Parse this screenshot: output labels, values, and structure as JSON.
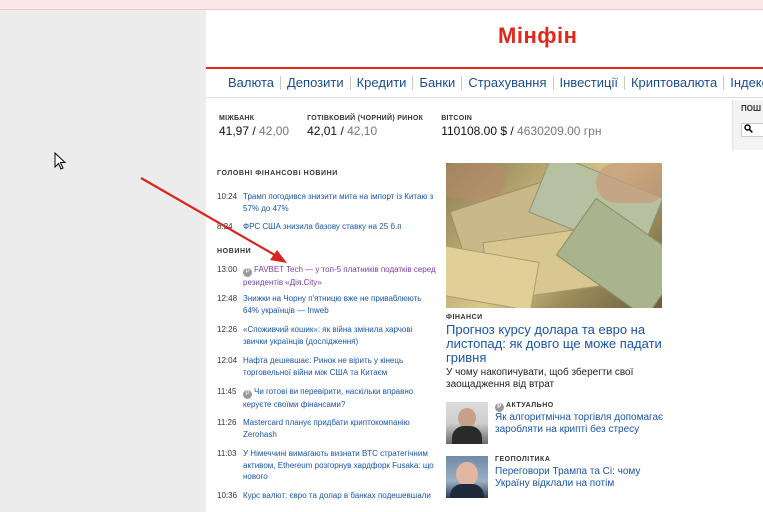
{
  "site": {
    "logo": "Мінфін"
  },
  "nav": [
    "Валюта",
    "Депозити",
    "Кредити",
    "Банки",
    "Страхування",
    "Інвестиції",
    "Криптовалюта",
    "Індекси"
  ],
  "rates": [
    {
      "label": "МІЖБАНК",
      "buy": "41,97",
      "sep": " / ",
      "sell": "42,00"
    },
    {
      "label": "ГОТІВКОВИЙ (ЧОРНИЙ) РИНОК",
      "buy": "42,01",
      "sep": " / ",
      "sell": "42,10"
    },
    {
      "label": "BITCOIN",
      "buy": "110108.00 $",
      "sep": " / ",
      "sell": "4630209.00 грн"
    }
  ],
  "side_search": {
    "label": "ПОШ"
  },
  "sections": {
    "main_news": "ГОЛОВНІ ФІНАНСОВІ НОВИНИ",
    "news": "НОВИНИ"
  },
  "main_news": [
    {
      "time": "10:24",
      "text": "Трамп погодився знизити мита на імпорт із Китаю з 57% до 47%"
    },
    {
      "time": "8:24",
      "text": "ФРС США знизила базову ставку на 25 б.п"
    }
  ],
  "news": [
    {
      "time": "13:00",
      "text": "FAVBET Tech — у топ-5 платників податків серед резидентів «Дія.City»",
      "pinned": true,
      "visited": true
    },
    {
      "time": "12:48",
      "text": "Знижки на Чорну п'ятницю вже не приваблюють 64% українців — Inweb"
    },
    {
      "time": "12:26",
      "text": "«Споживчий кошик»: як війна змінила харчові звички українців (дослідження)"
    },
    {
      "time": "12:04",
      "text": "Нафта дешевшає: Ринок не вірить у кінець торговельної війни між США та Китаєм"
    },
    {
      "time": "11:45",
      "text": "Чи готові ви перевірити, наскільки вправно керуєте своїми фінансами?",
      "pinned": true
    },
    {
      "time": "11:26",
      "text": "Mastercard планує придбати криптокомпанію Zerohash"
    },
    {
      "time": "11:03",
      "text": "У Німеччині вимагають визнати BTC стратегічним активом, Ethereum розгорнув хардфорк Fusaka: що нового"
    },
    {
      "time": "10:36",
      "text": "Курс валют: євро та долар в банках подешевшали"
    }
  ],
  "hero": {
    "category": "ФІНАНСИ",
    "title": "Прогноз курсу долара та евро на листопад: як довго ще може падати гривня",
    "subtitle": "У чому накопичувати, щоб зберегти свої заощадження від втрат"
  },
  "side_articles": [
    {
      "category": "АКТУАЛЬНО",
      "title": "Як алгоритмічна торгівля допомагає заробляти на крипті без стресу",
      "pinned": true
    },
    {
      "category": "ГЕОПОЛІТИКА",
      "title": "Переговори Трампа та Сі: чому Україну відклали на потім"
    }
  ],
  "colors": {
    "brand": "#e2271b",
    "link": "#1a55a6",
    "visited": "#7a3e9d",
    "annotation_arrow": "#d9261c"
  }
}
